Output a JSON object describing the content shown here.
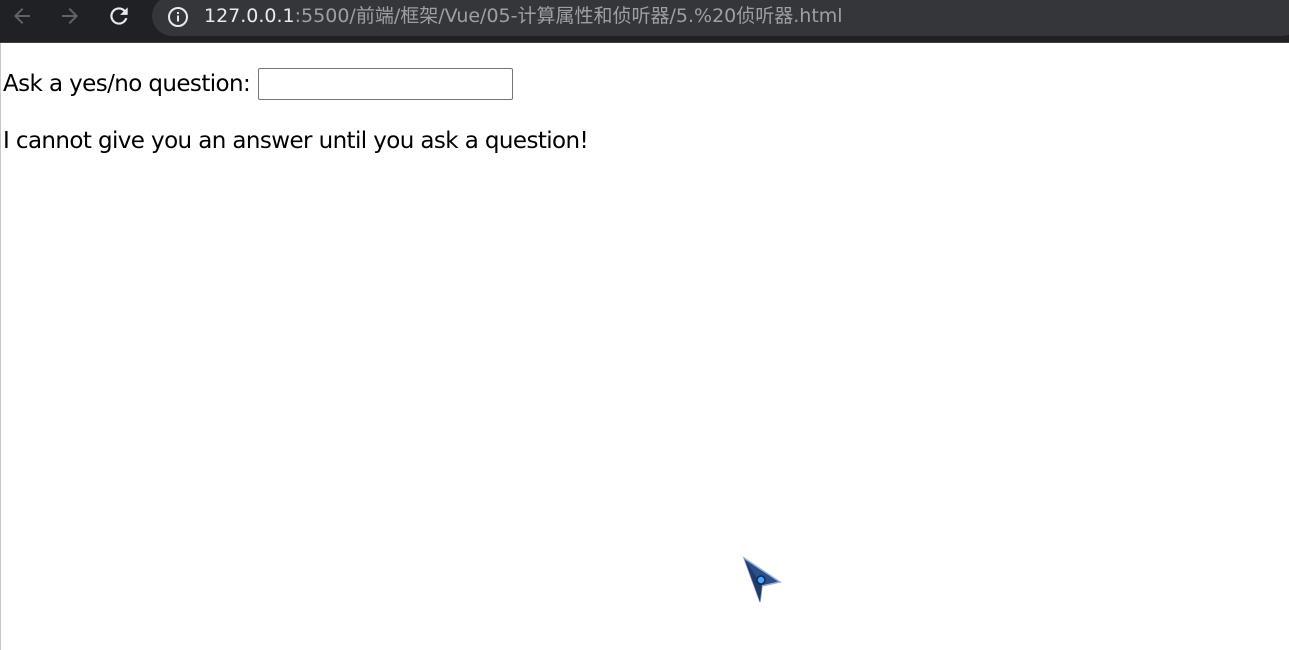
{
  "browser": {
    "url_host": "127.0.0.1",
    "url_rest": ":5500/前端/框架/Vue/05-计算属性和侦听器/5.%20侦听器.html",
    "icons": {
      "back": "arrow-left-icon",
      "forward": "arrow-right-icon",
      "reload": "reload-icon",
      "info": "info-icon"
    },
    "colors": {
      "toolbar": "#202124",
      "omnibox": "#35363a",
      "url_host": "#e8eaed",
      "url_rest": "#9aa0a6"
    }
  },
  "page": {
    "question_label": "Ask a yes/no question:",
    "question_value": "",
    "answer_text": "I cannot give you an answer until you ask a question!"
  },
  "cursor": {
    "icon": "pointer-arrow-icon"
  }
}
